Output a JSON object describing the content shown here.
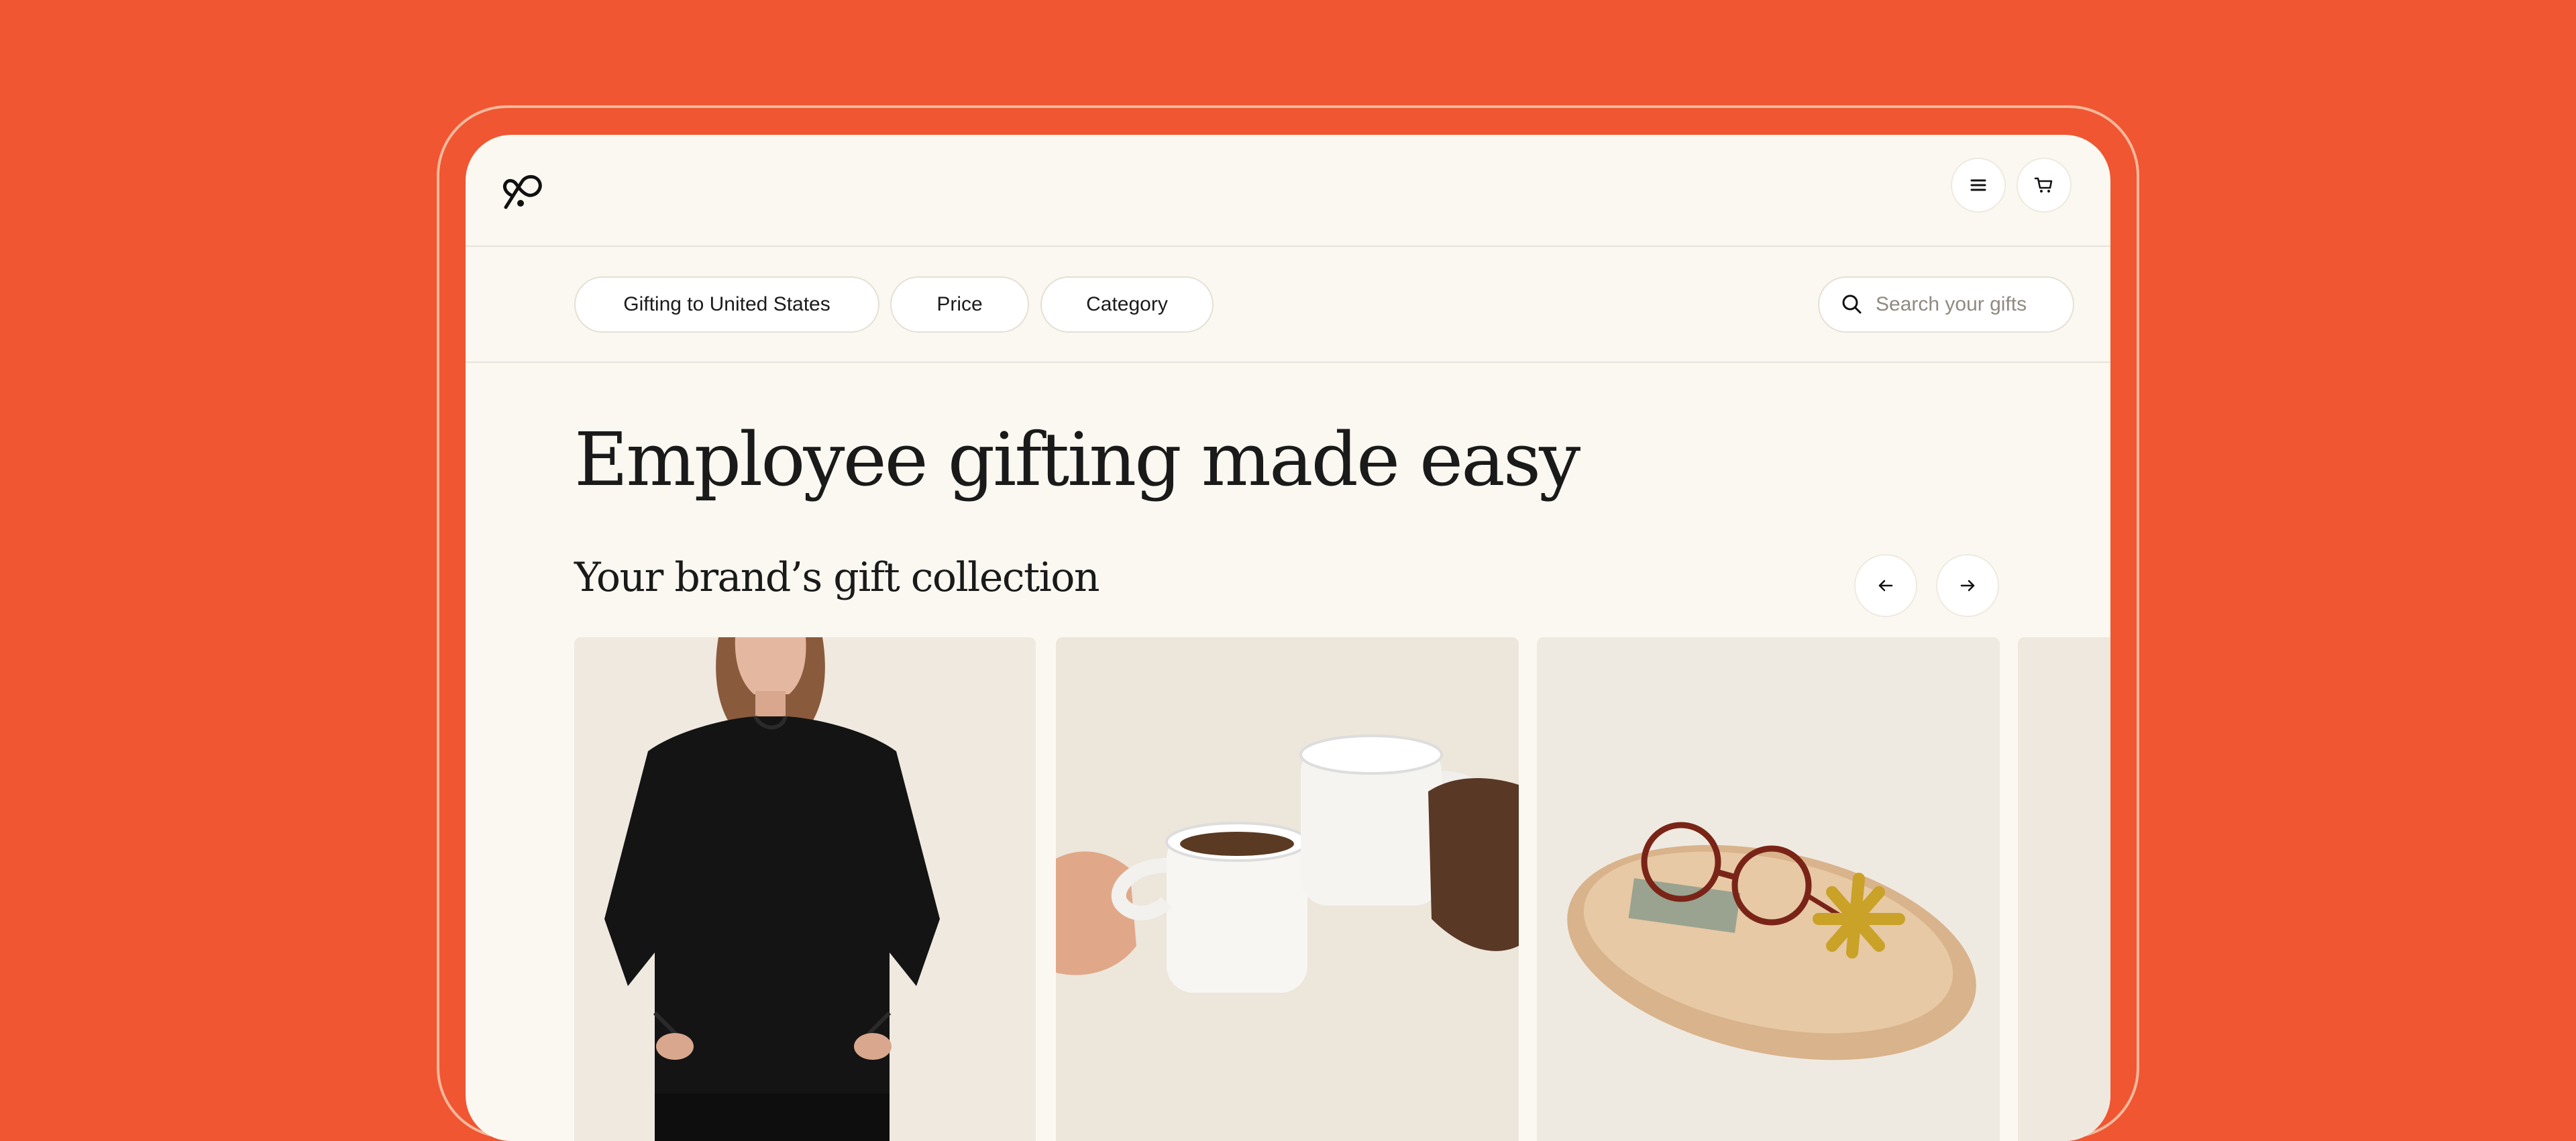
{
  "colors": {
    "background": "#EF5631",
    "screen": "#FBF8F1",
    "outline": "#F5B89C",
    "text": "#1A1A1A",
    "placeholder": "#8F8A82"
  },
  "header": {
    "logo_icon": "infinity-heart-logo-icon",
    "menu_icon": "hamburger-menu-icon",
    "cart_icon": "shopping-cart-icon"
  },
  "filters": {
    "country": "Gifting to United States",
    "price": "Price",
    "category": "Category"
  },
  "search": {
    "icon": "search-icon",
    "placeholder": "Search your gifts",
    "value": ""
  },
  "hero": {
    "title": "Employee gifting made easy"
  },
  "collection": {
    "title": "Your brand’s gift collection",
    "prev_icon": "arrow-left-icon",
    "next_icon": "arrow-right-icon",
    "products": [
      {
        "image": "black-sweater-photo"
      },
      {
        "image": "white-mugs-photo"
      },
      {
        "image": "wooden-tray-photo"
      },
      {
        "image": "partial-product-photo"
      }
    ]
  }
}
